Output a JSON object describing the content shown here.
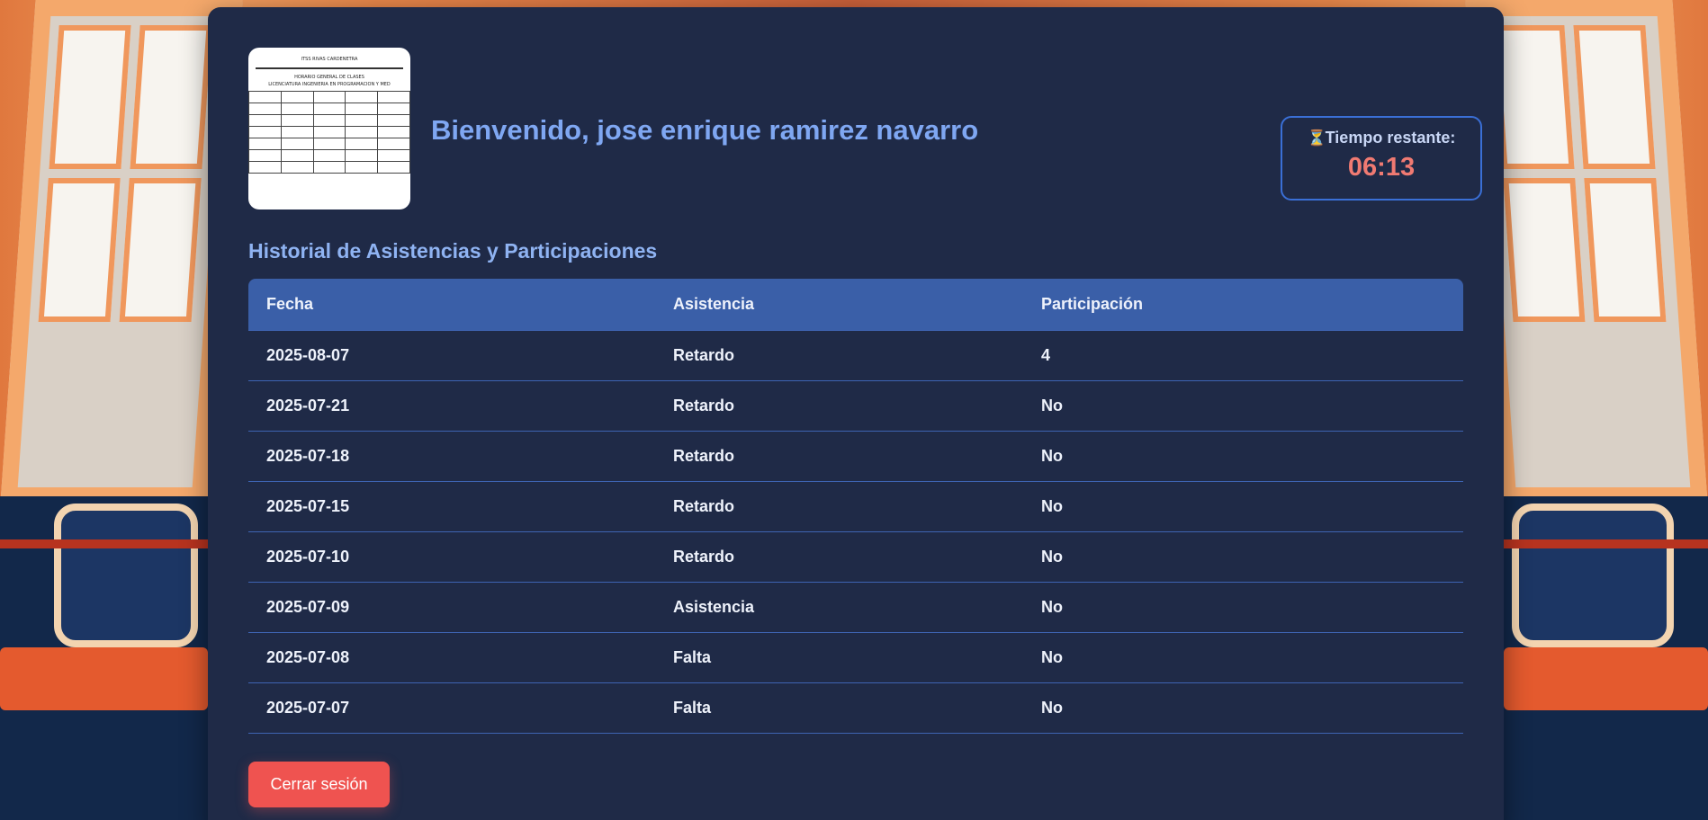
{
  "header": {
    "welcome": "Bienvenido, jose enrique ramirez navarro",
    "logo_lines": [
      "ITSS RIVAS CARDENETRA",
      "HORARIO GENERAL DE CLASES",
      "LICENCIATURA INGENIERIA EN PROGRAMACION Y MED"
    ]
  },
  "timer": {
    "icon": "hourglass-icon",
    "label": "Tiempo restante:",
    "value": "06:13"
  },
  "history": {
    "title": "Historial de Asistencias y Participaciones",
    "columns": [
      "Fecha",
      "Asistencia",
      "Participación"
    ],
    "rows": [
      [
        "2025-08-07",
        "Retardo",
        "4"
      ],
      [
        "2025-07-21",
        "Retardo",
        "No"
      ],
      [
        "2025-07-18",
        "Retardo",
        "No"
      ],
      [
        "2025-07-15",
        "Retardo",
        "No"
      ],
      [
        "2025-07-10",
        "Retardo",
        "No"
      ],
      [
        "2025-07-09",
        "Asistencia",
        "No"
      ],
      [
        "2025-07-08",
        "Falta",
        "No"
      ],
      [
        "2025-07-07",
        "Falta",
        "No"
      ]
    ]
  },
  "actions": {
    "logout_label": "Cerrar sesión"
  },
  "colors": {
    "card": "#1f2a47",
    "accent": "#7fa7f2",
    "header_row": "#3a5fa8",
    "timer_value": "#f07a72",
    "logout": "#ef5350"
  }
}
